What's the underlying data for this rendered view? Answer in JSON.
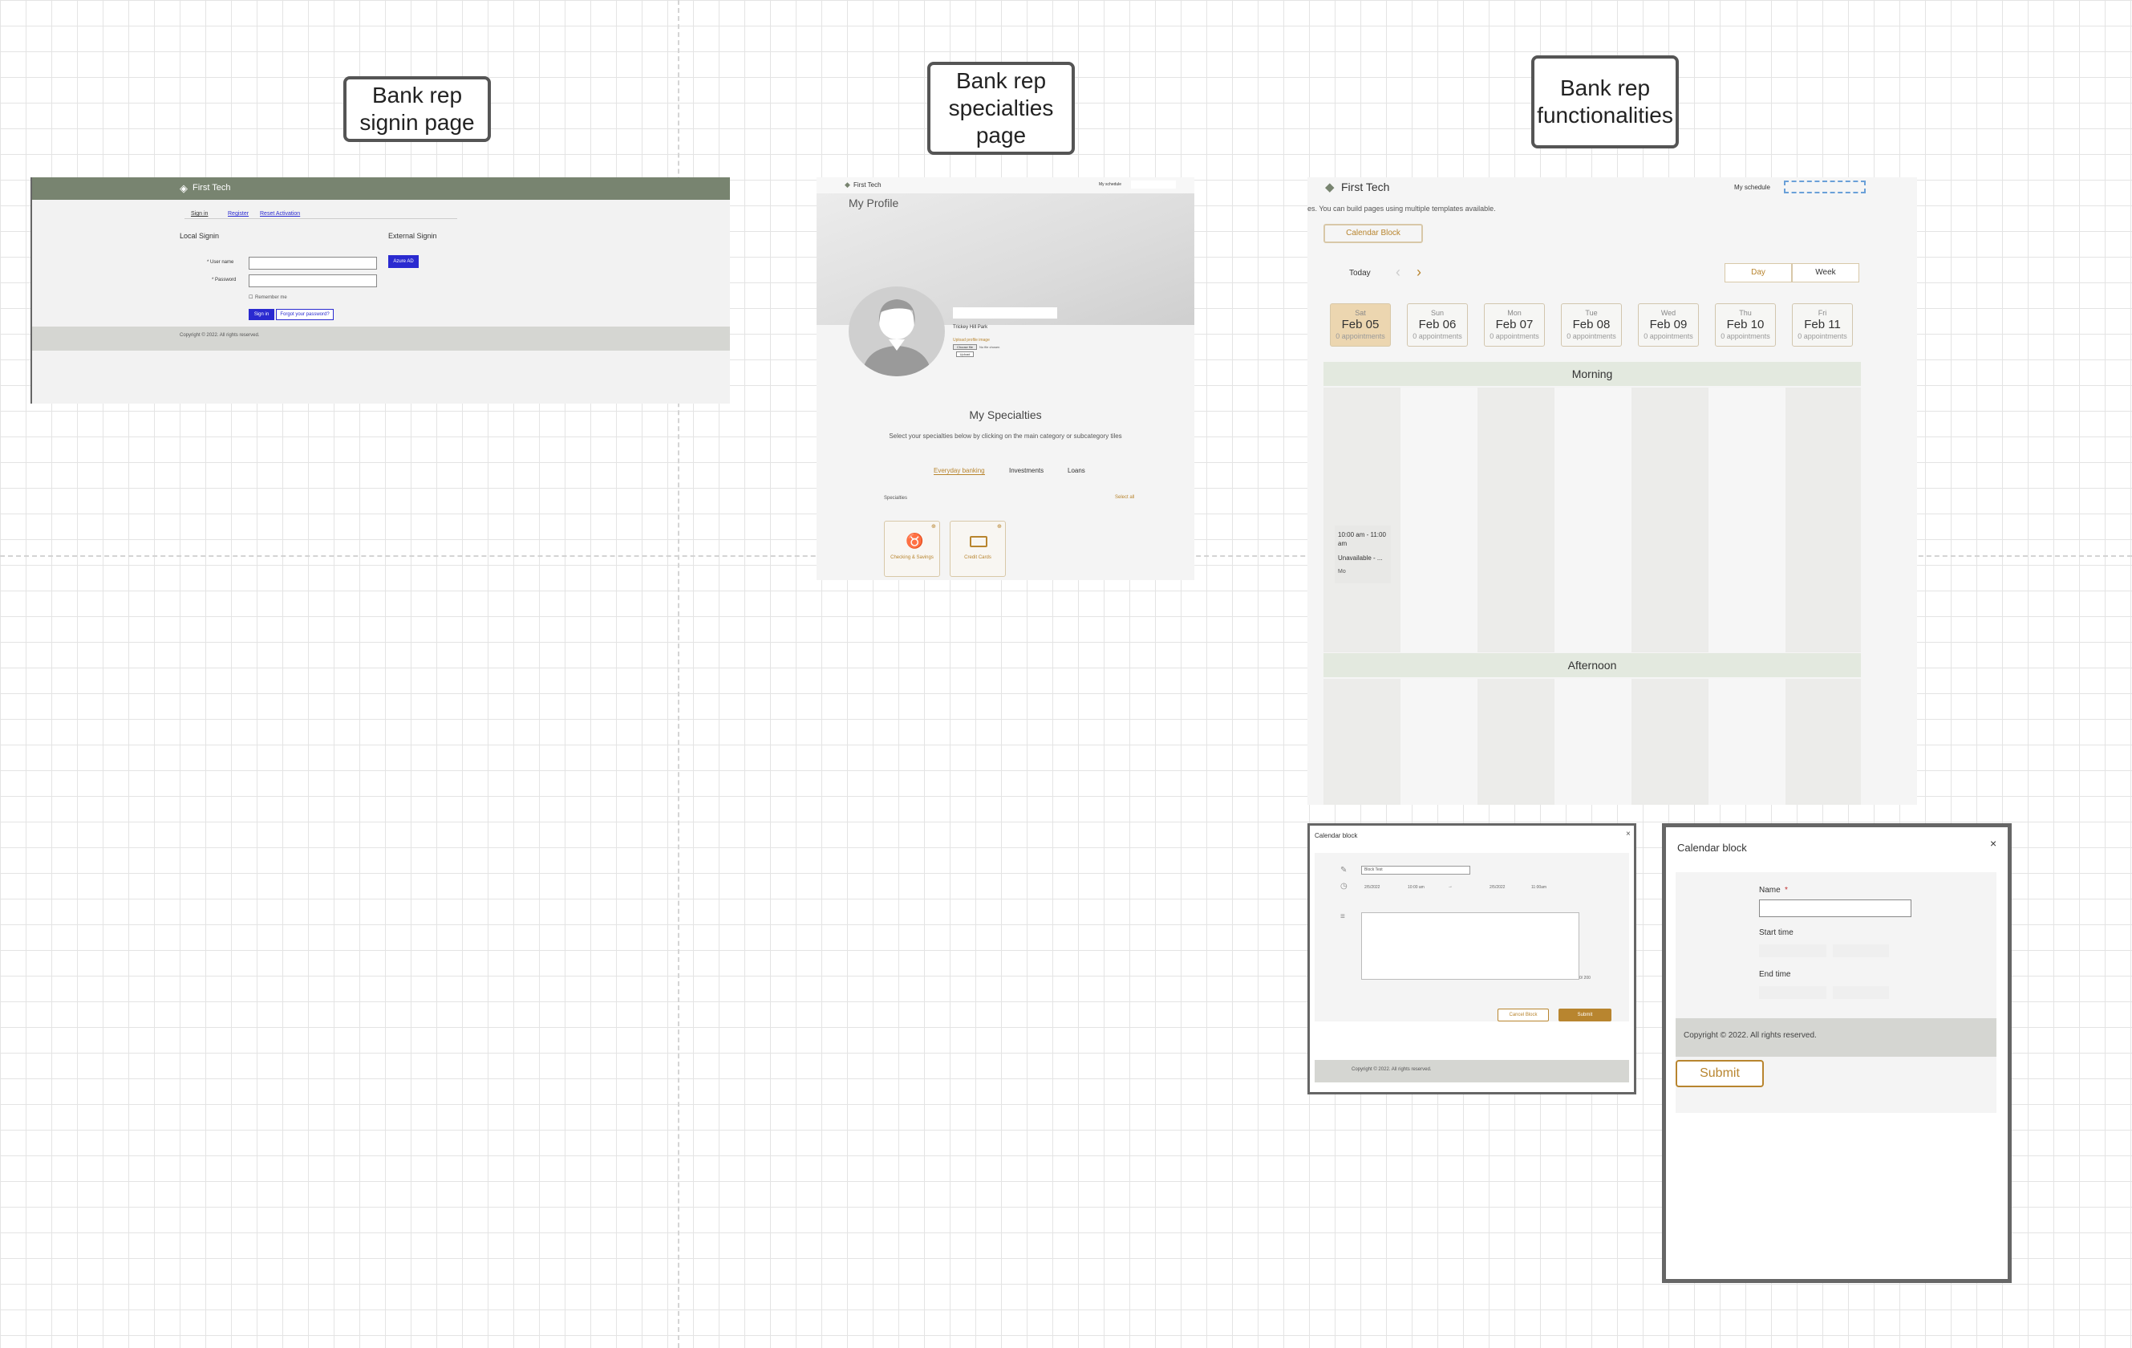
{
  "labels": {
    "signin": "Bank rep signin page",
    "specialties": "Bank rep specialties page",
    "functionalities": "Bank rep functionalities"
  },
  "signin": {
    "brand": "First Tech",
    "tabs": [
      "Sign in",
      "Register",
      "Reset Activation"
    ],
    "local_title": "Local Signin",
    "external_title": "External Signin",
    "username_label": "* User name",
    "password_label": "* Password",
    "remember_label": "Remember me",
    "signin_button": "Sign in",
    "forgot_button": "Forgot your password?",
    "azure_button": "Azure AD",
    "footer": "Copyright © 2022. All rights reserved."
  },
  "profile": {
    "brand": "First Tech",
    "nav_link": "My schedule",
    "title": "My Profile",
    "rep_name": "Trickey Hill Park",
    "upload_label": "Upload profile image",
    "choose_file": "Choose file",
    "no_file": "No file chosen",
    "upload_button": "Upload",
    "specialties_title": "My Specialties",
    "specialties_subtitle": "Select your specialties below by clicking on the main category or subcategory tiles",
    "tabs": [
      "Everyday banking",
      "Investments",
      "Loans"
    ],
    "list_label": "Specialties",
    "select_all": "Select all",
    "tiles": [
      "Checking & Savings",
      "Credit Cards"
    ]
  },
  "calendar": {
    "brand": "First Tech",
    "nav_link": "My schedule",
    "note": "es. You can build pages using multiple templates available.",
    "block_button": "Calendar Block",
    "today": "Today",
    "view_day": "Day",
    "view_week": "Week",
    "days": [
      {
        "name": "Sat",
        "date": "Feb 05",
        "appts": "0 appointments",
        "selected": true
      },
      {
        "name": "Sun",
        "date": "Feb 06",
        "appts": "0 appointments"
      },
      {
        "name": "Mon",
        "date": "Feb 07",
        "appts": "0 appointments"
      },
      {
        "name": "Tue",
        "date": "Feb 08",
        "appts": "0 appointments"
      },
      {
        "name": "Wed",
        "date": "Feb 09",
        "appts": "0 appointments"
      },
      {
        "name": "Thu",
        "date": "Feb 10",
        "appts": "0 appointments"
      },
      {
        "name": "Fri",
        "date": "Feb 11",
        "appts": "0 appointments"
      }
    ],
    "morning": "Morning",
    "afternoon": "Afternoon",
    "event_time": "10:00 am - 11:00 am",
    "event_title": "Unavailable - ...",
    "event_meta": "Mo"
  },
  "block_modal_a": {
    "title": "Calendar block",
    "name_value": "Block Test",
    "start_date": "2/5/2022",
    "start_time": "10:00 am",
    "end_date": "2/5/2022",
    "end_time": "11:00am",
    "counter": "0/ 200",
    "cancel": "Cancel Block",
    "submit": "Submit",
    "footer": "Copyright © 2022. All rights reserved."
  },
  "block_modal_b": {
    "title": "Calendar block",
    "close": "×",
    "name_label": "Name",
    "required": "*",
    "start_label": "Start time",
    "end_label": "End time",
    "footer": "Copyright © 2022. All rights reserved.",
    "submit": "Submit"
  },
  "colors": {
    "brand_gold": "#b8852f",
    "header_green": "#788470",
    "azure_blue": "#2a2ad0",
    "section_green": "#e3e9df"
  }
}
